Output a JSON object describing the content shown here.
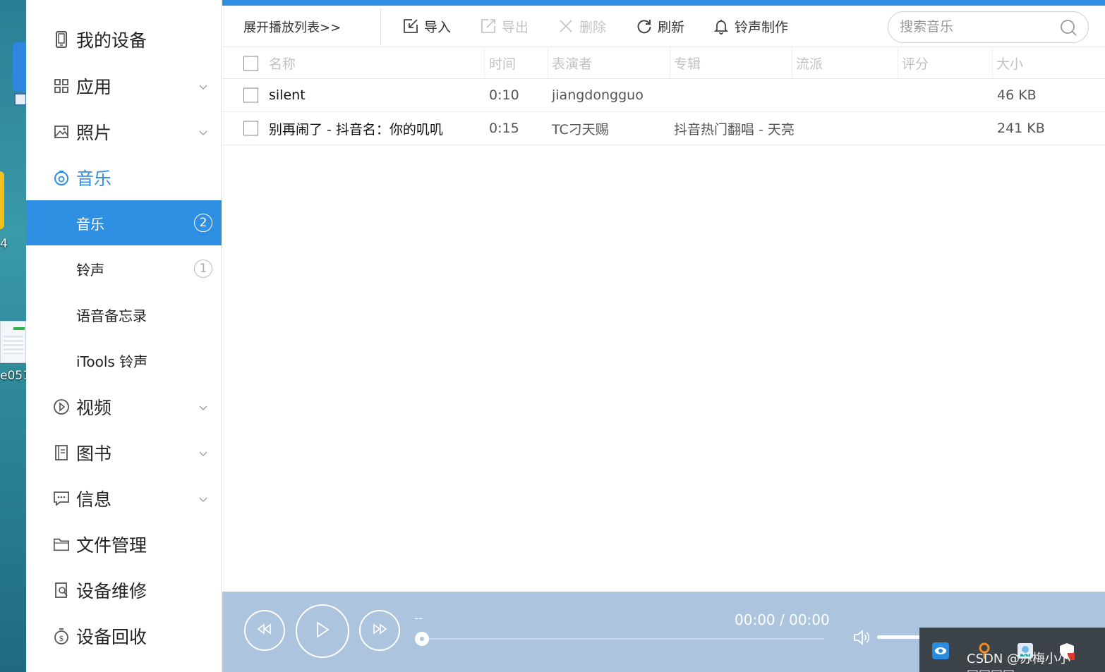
{
  "desktop": {
    "label_1": "4",
    "label_2": "e051"
  },
  "sidebar": {
    "items": [
      {
        "label": "我的设备",
        "icon": "phone-icon"
      },
      {
        "label": "应用",
        "icon": "apps-grid-icon"
      },
      {
        "label": "照片",
        "icon": "photo-icon"
      },
      {
        "label": "音乐",
        "icon": "music-icon"
      },
      {
        "label": "视频",
        "icon": "video-icon"
      },
      {
        "label": "图书",
        "icon": "book-icon"
      },
      {
        "label": "信息",
        "icon": "message-icon"
      },
      {
        "label": "文件管理",
        "icon": "folder-icon"
      },
      {
        "label": "设备维修",
        "icon": "repair-icon"
      },
      {
        "label": "设备回收",
        "icon": "recycle-money-icon"
      }
    ],
    "music_sub": [
      {
        "label": "音乐",
        "count": "2",
        "active": true
      },
      {
        "label": "铃声",
        "count": "1",
        "active": false
      },
      {
        "label": "语音备忘录"
      },
      {
        "label": "iTools 铃声"
      }
    ]
  },
  "toolbar": {
    "expand_label": "展开播放列表>>",
    "import_label": "导入",
    "export_label": "导出",
    "delete_label": "删除",
    "refresh_label": "刷新",
    "ringtone_label": "铃声制作",
    "search_placeholder": "搜索音乐"
  },
  "table": {
    "headers": {
      "name": "名称",
      "time": "时间",
      "artist": "表演者",
      "album": "专辑",
      "genre": "流派",
      "rating": "评分",
      "size": "大小"
    },
    "rows": [
      {
        "name": "silent",
        "time": "0:10",
        "artist": "jiangdongguo",
        "album": "",
        "genre": "",
        "rating": "",
        "size": "46 KB"
      },
      {
        "name": "别再闹了 - 抖音名：你的叽叽",
        "time": "0:15",
        "artist": "TC刁天赐",
        "album": "抖音热门翻唱 - 天亮",
        "genre": "",
        "rating": "",
        "size": "241 KB"
      }
    ]
  },
  "player": {
    "track_title": "--",
    "time": "00:00 / 00:00",
    "progress": 0,
    "volume": 0.5
  },
  "watermark": "CSDN @苏梅小小□□□□",
  "colors": {
    "accent": "#2f8fe3",
    "player_bg": "#acc4de",
    "tray_bg": "#3c4348"
  }
}
